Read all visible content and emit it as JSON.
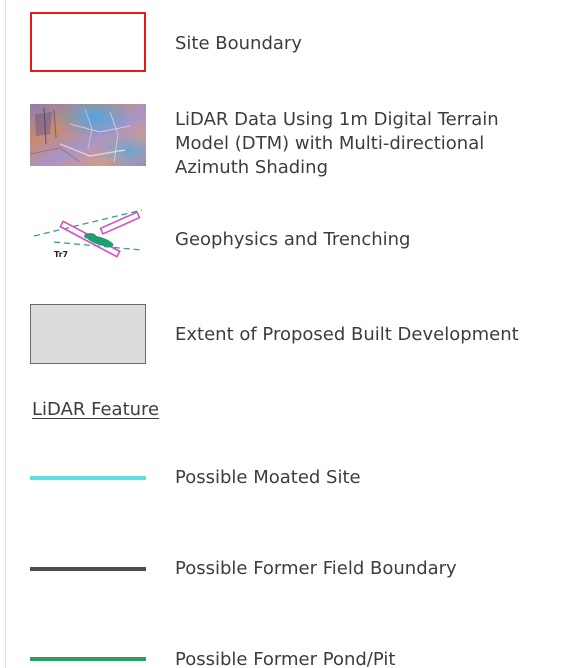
{
  "legend": {
    "site_boundary": {
      "label": "Site Boundary",
      "color": "#e31b1b",
      "symbol": "red-outline-box"
    },
    "lidar_data": {
      "label": "LiDAR Data Using 1m Digital Terrain\nModel (DTM) with Multi-directional\nAzimuth Shading",
      "symbol": "lidar-hillshade-swatch"
    },
    "geophysics": {
      "label": "Geophysics and Trenching",
      "trench_label": "Tr7",
      "colors": {
        "trench": "#d64fc0",
        "anomaly": "#1f9e73",
        "dashed": "#2fa38c"
      }
    },
    "built_development": {
      "label": "Extent of Proposed Built Development",
      "fill": "#dcdcdc",
      "stroke": "#6b6b6b"
    },
    "feature_heading": "LiDAR Feature",
    "features": [
      {
        "label": "Possible Moated Site",
        "color": "#5ee0e6"
      },
      {
        "label": "Possible Former Field Boundary",
        "color": "#4d4d4d"
      },
      {
        "label": "Possible Former Pond/Pit",
        "color": "#2e9b68"
      }
    ]
  }
}
